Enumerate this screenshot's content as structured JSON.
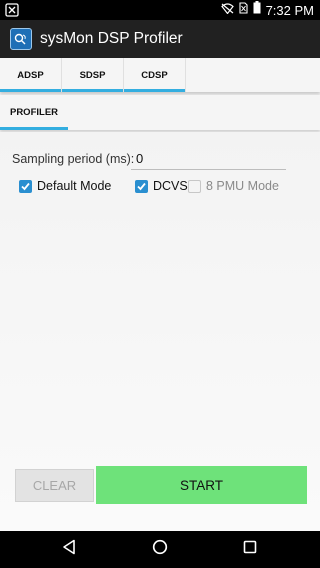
{
  "status_bar": {
    "time": "7:32 PM"
  },
  "app_bar": {
    "title": "sysMon DSP Profiler"
  },
  "top_tabs": [
    {
      "label": "ADSP",
      "selected": true
    },
    {
      "label": "SDSP",
      "selected": false
    },
    {
      "label": "CDSP",
      "selected": false
    }
  ],
  "sub_tabs": [
    {
      "label": "PROFILER",
      "selected": true
    }
  ],
  "form": {
    "sampling_label": "Sampling period (ms):",
    "sampling_value": "0",
    "default_mode": {
      "label": "Default Mode",
      "checked": true
    },
    "dcvs": {
      "label": "DCVS",
      "checked": true
    },
    "pmu_mode": {
      "label": "8 PMU Mode",
      "checked": false,
      "enabled": false
    }
  },
  "buttons": {
    "clear": "CLEAR",
    "start": "START"
  },
  "colors": {
    "accent": "#33aee0",
    "checkbox": "#2a8fd0",
    "start_button": "#6ee27a",
    "app_bar": "#212121"
  }
}
